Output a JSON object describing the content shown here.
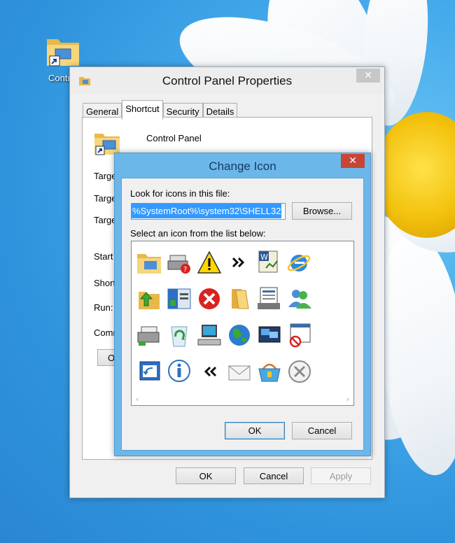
{
  "desktop": {
    "icon_label": "Control"
  },
  "properties": {
    "title": "Control Panel Properties",
    "close_symbol": "✕",
    "tabs": [
      {
        "label": "General",
        "active": false
      },
      {
        "label": "Shortcut",
        "active": true
      },
      {
        "label": "Security",
        "active": false
      },
      {
        "label": "Details",
        "active": false
      }
    ],
    "shortcut_name": "Control Panel",
    "field_labels": [
      "Targe",
      "Targe",
      "Targe",
      "Start",
      "Short",
      "Run:",
      "Comm"
    ],
    "partial_button_label": "O",
    "buttons": {
      "ok": "OK",
      "cancel": "Cancel",
      "apply": "Apply"
    }
  },
  "change_icon": {
    "title": "Change Icon",
    "close_symbol": "✕",
    "look_for_label": "Look for icons in this file:",
    "file_path": "%SystemRoot%\\system32\\SHELL32",
    "browse_label": "Browse...",
    "select_label": "Select an icon from the list below:",
    "icons": [
      "folder-icon",
      "printer-help-icon",
      "warning-icon",
      "forward-arrows-icon",
      "document-chart-icon",
      "internet-explorer-icon",
      "folder-up-arrow-icon",
      "start-menu-icon",
      "error-x-icon",
      "open-folder-icon",
      "server-document-icon",
      "users-icon",
      "network-printer-icon",
      "recycle-bin-icon",
      "computer-icon",
      "globe-icon",
      "network-windows-icon",
      "blocked-window-icon",
      "back-window-icon",
      "information-icon",
      "back-arrows-icon",
      "envelope-icon",
      "shopping-basket-icon",
      "gray-x-icon"
    ],
    "scroll_left": "‹",
    "scroll_right": "›",
    "ok_label": "OK",
    "cancel_label": "Cancel"
  }
}
